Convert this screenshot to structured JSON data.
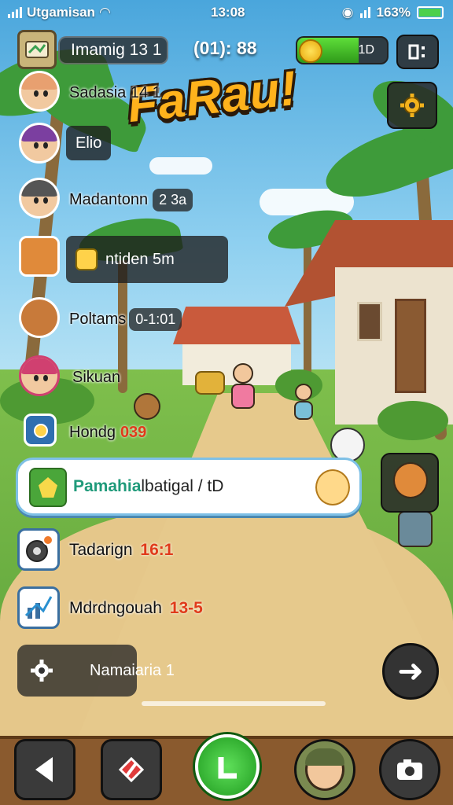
{
  "status_bar": {
    "carrier": "Utgamisan",
    "time": "13:08",
    "battery": "163%",
    "battery_level": 0.95
  },
  "hud": {
    "player_name": "Imamig 13 1",
    "timer": "(01): 88",
    "energy_label": "1D",
    "energy_level": 0.68,
    "menu_icon": "grid-menu-icon",
    "settings_icon": "gear-icon"
  },
  "title": "FaRau!",
  "friends": [
    {
      "name": "Sadasia 14 1",
      "avatar_color": "#e8a070"
    },
    {
      "name": "Elio",
      "avatar_color": "#7b3fa0"
    },
    {
      "name": "Madantonn",
      "badge": "2 3a",
      "avatar_color": "#555555"
    },
    {
      "name": "ntiden 5m",
      "avatar_color": "#e08a3a"
    },
    {
      "name": "Poltams",
      "badge": "0-1:01",
      "avatar_color": "#c87a3a"
    },
    {
      "name": "Sikuan",
      "avatar_color": "#d04070"
    },
    {
      "name": "Hondg",
      "number": "039",
      "avatar_color": "#2f6fb0"
    }
  ],
  "quest": {
    "title": "Pamahia",
    "tail": "lbatigal / tD"
  },
  "rows": [
    {
      "label": "Tadarign",
      "number": "16:1",
      "icon": "gear-alert-icon"
    },
    {
      "label": "Mdrdngouah",
      "number": "13-5",
      "icon": "chart-icon"
    }
  ],
  "settings_row": {
    "label": "Namaiaria 1",
    "icon": "gear-icon"
  },
  "bottom_bar": {
    "back_icon": "back-arrow-icon",
    "map_icon": "map-marker-icon",
    "play_icon": "play-icon",
    "profile_icon": "avatar-icon",
    "camera_icon": "camera-icon"
  },
  "colors": {
    "accent_green": "#2f9a1a",
    "title_orange": "#ffb21c",
    "quest_text": "#1f9a7a",
    "number_red": "#e03a1a"
  }
}
